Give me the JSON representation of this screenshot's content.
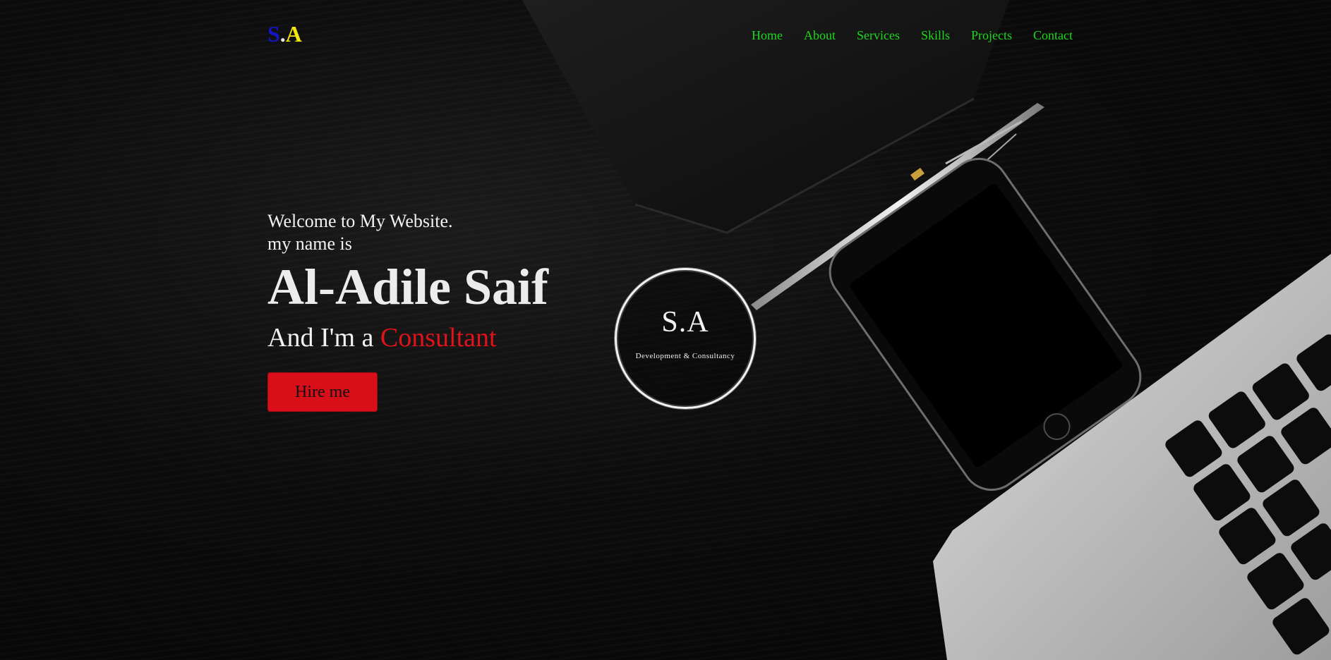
{
  "brand": {
    "logo_s": "S",
    "logo_dot": ".",
    "logo_a": "A"
  },
  "nav": {
    "items": [
      {
        "label": "Home"
      },
      {
        "label": "About"
      },
      {
        "label": "Services"
      },
      {
        "label": "Skills"
      },
      {
        "label": "Projects"
      },
      {
        "label": "Contact"
      }
    ]
  },
  "hero": {
    "welcome": "Welcome to My Website.",
    "intro": "my name is",
    "name": "Al-Adile Saif",
    "role_prefix": "And I'm a",
    "role_accent": "Consultant",
    "cta": "Hire me"
  },
  "badge": {
    "mark": "S.A",
    "tagline": "Development & Consultancy"
  },
  "colors": {
    "nav_link": "#1fd71f",
    "logo_s": "#1414c8",
    "logo_a": "#f2e70c",
    "accent": "#e0121a",
    "button_bg": "#d80f18"
  }
}
